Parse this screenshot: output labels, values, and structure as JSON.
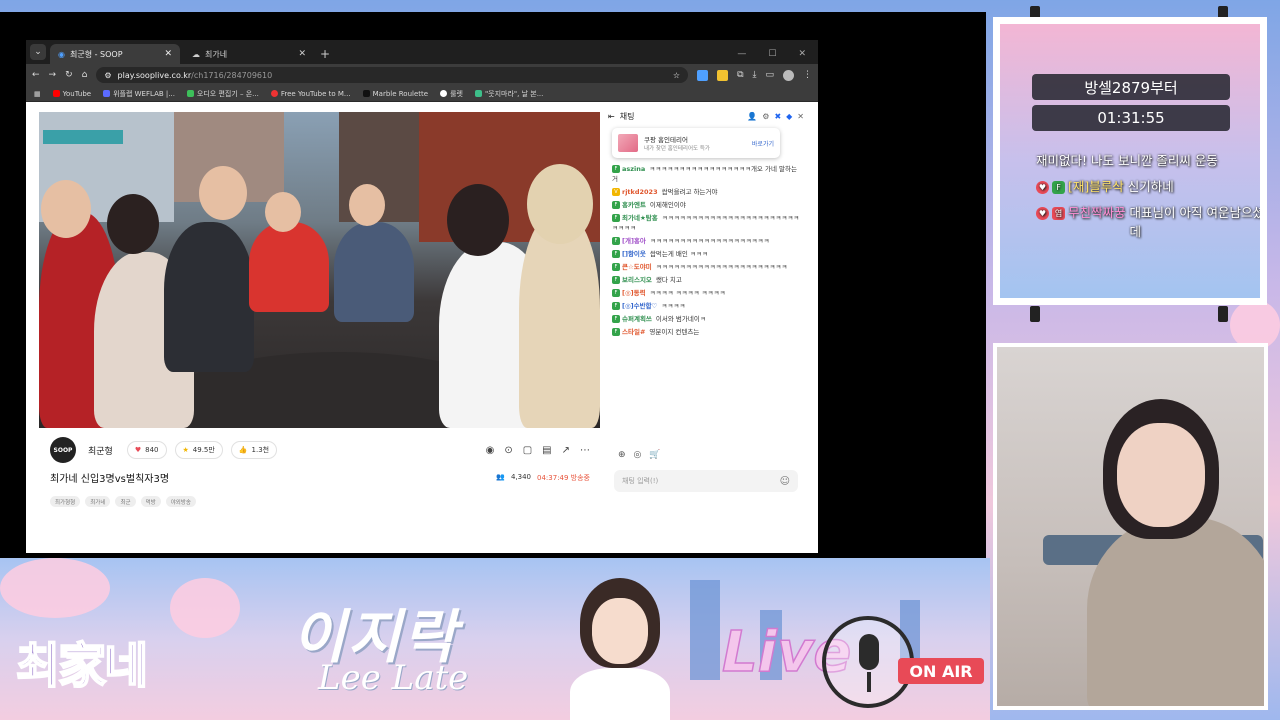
{
  "browser": {
    "tabs": [
      {
        "label": "최군형 - SOOP",
        "active": true
      },
      {
        "label": "최가네",
        "active": false
      }
    ],
    "url_host": "play.sooplive.co.kr",
    "url_path": "/ch1716/284709610",
    "bookmarks": [
      "YouTube",
      "위플랩 WEFLAB |...",
      "오디오 편집기 – 온...",
      "Free YouTube to M...",
      "Marble Roulette",
      "룰렛",
      "\"웃지마라\", 날 본..."
    ]
  },
  "player": {
    "streamer_name": "최군형",
    "logo_text": "SOOP",
    "likes": "840",
    "stars": "49.5만",
    "thumbs": "1.3천",
    "title": "최가네 신입3명vs벌칙자3명",
    "viewers": "4,340",
    "elapsed": "04:37:49 방송중",
    "tags": [
      "최가형형",
      "최가네",
      "최군",
      "먹방",
      "야외방송"
    ]
  },
  "chat": {
    "header": "채팅",
    "promo_title": "쿠팡 홈인테리어",
    "promo_sub": "내가 찾던 홈인테리어도 득가",
    "promo_action": "바로가기",
    "messages": [
      {
        "nick": "aszina",
        "text": "ㅋㅋㅋㅋㅋㅋㅋㅋㅋㅋㅋㅋㅋㅋㅋㅋㅋ개오 가네 말하는거",
        "color": "#2f8f4f"
      },
      {
        "nick": "rjtkd2023",
        "text": "쌉먹을려고 하는거야",
        "color": "#e0572e"
      },
      {
        "nick": "홍카엔트",
        "text": "이제해인이야",
        "color": "#2f8f4f"
      },
      {
        "nick": "최가네★탐홍",
        "text": "ㅋㅋㅋㅋㅋㅋㅋㅋㅋㅋㅋㅋㅋㅋㅋㅋㅋㅋㅋㅋㅋㅋㅋㅋㅋㅋㅋ",
        "color": "#2f8f4f"
      },
      {
        "nick": "[개]홍아",
        "text": "ㅋㅋㅋㅋㅋㅋㅋㅋㅋㅋㅋㅋㅋㅋㅋㅋㅋㅋㅋㅋ",
        "color": "#a04fc8"
      },
      {
        "nick": "[]항이웃",
        "text": "쌉먹는게 배인 ㅋㅋㅋ",
        "color": "#3366cc"
      },
      {
        "nick": "큰☆도야미",
        "text": "ㅋㅋㅋㅋㅋㅋㅋㅋㅋㅋㅋㅋㅋㅋㅋㅋㅋㅋㅋㅋㅋㅋ",
        "color": "#e0572e"
      },
      {
        "nick": "보리스지오",
        "text": "쌨다 치고",
        "color": "#2f8f4f"
      },
      {
        "nick": "[◎]동력",
        "text": "ㅋㅋㅋㅋ ㅋㅋㅋㅋ ㅋㅋㅋㅋ",
        "color": "#e0572e"
      },
      {
        "nick": "[◎]수반합♡",
        "text": "ㅋㅋㅋㅋ",
        "color": "#3366cc"
      },
      {
        "nick": "슈퍼계획쓰",
        "text": "이서와 범가네이ㅋ",
        "color": "#2f8f4f"
      },
      {
        "nick": "스타일#",
        "text": "영분이지 컨텐츠는",
        "color": "#e0572e"
      }
    ],
    "input_placeholder": "채팅 입력(!)"
  },
  "overlay": {
    "goal_label": "방셀2879부터",
    "timer": "01:31:55",
    "notices": [
      {
        "prefix": "",
        "name": "",
        "text": "재미없다! 나도 보니깐 졸리씨 운동"
      },
      {
        "prefix": "F",
        "name": "[재]블루삭",
        "text": "신기하네"
      },
      {
        "prefix": "염",
        "name": "무친짝짜꿍",
        "text": "대표님이 아직 여운남으셨나 싶었는데"
      }
    ],
    "banner_logo": "최家네",
    "banner_name": "이지락",
    "banner_sub": "Lee Late",
    "live_label": "Live",
    "on_air_label": "ON AIR"
  },
  "colors": {
    "accent_red": "#e84a57",
    "soop_blue": "#1e64f0"
  }
}
